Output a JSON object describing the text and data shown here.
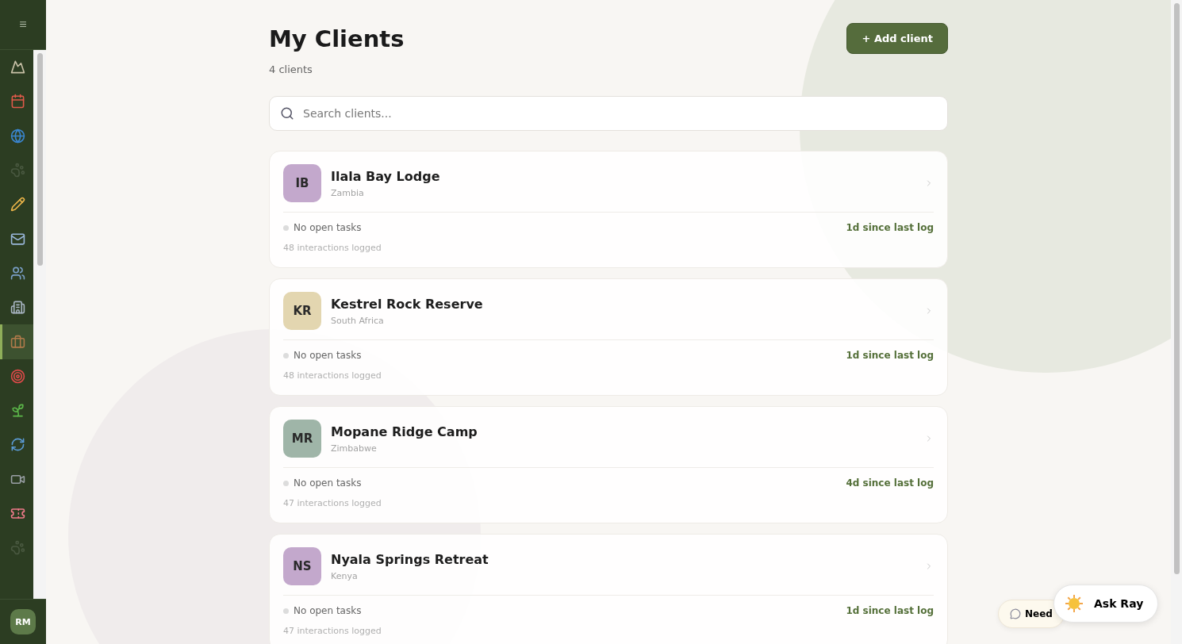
{
  "sidebar": {
    "menu_icon": "≡",
    "items": [
      {
        "selected": false,
        "dimmed": false
      },
      {
        "selected": false,
        "dimmed": false
      },
      {
        "selected": false,
        "dimmed": false
      },
      {
        "selected": false,
        "dimmed": true
      },
      {
        "selected": false,
        "dimmed": false
      },
      {
        "selected": false,
        "dimmed": false
      },
      {
        "selected": false,
        "dimmed": false
      },
      {
        "selected": false,
        "dimmed": false
      },
      {
        "selected": true,
        "dimmed": false
      },
      {
        "selected": false,
        "dimmed": false
      },
      {
        "selected": false,
        "dimmed": false
      },
      {
        "selected": false,
        "dimmed": false
      },
      {
        "selected": false,
        "dimmed": false
      },
      {
        "selected": false,
        "dimmed": false
      },
      {
        "selected": false,
        "dimmed": true
      }
    ],
    "user_initials": "RM"
  },
  "header": {
    "title": "My Clients",
    "count": "4 clients",
    "add_button": "+ Add client"
  },
  "search": {
    "placeholder": "Search clients..."
  },
  "clients": [
    {
      "initials": "IB",
      "color": "#c3a8cc",
      "name": "Ilala Bay Lodge",
      "country": "Zambia",
      "tasks": "No open tasks",
      "last_log": "1d since last log",
      "interactions": "48 interactions logged"
    },
    {
      "initials": "KR",
      "color": "#e3d6b0",
      "name": "Kestrel Rock Reserve",
      "country": "South Africa",
      "tasks": "No open tasks",
      "last_log": "1d since last log",
      "interactions": "48 interactions logged"
    },
    {
      "initials": "MR",
      "color": "#9fb5a8",
      "name": "Mopane Ridge Camp",
      "country": "Zimbabwe",
      "tasks": "No open tasks",
      "last_log": "4d since last log",
      "interactions": "47 interactions logged"
    },
    {
      "initials": "NS",
      "color": "#c3a8cc",
      "name": "Nyala Springs Retreat",
      "country": "Kenya",
      "tasks": "No open tasks",
      "last_log": "1d since last log",
      "interactions": "47 interactions logged"
    }
  ],
  "help_button": "Need",
  "ask_button": "Ask Ray"
}
